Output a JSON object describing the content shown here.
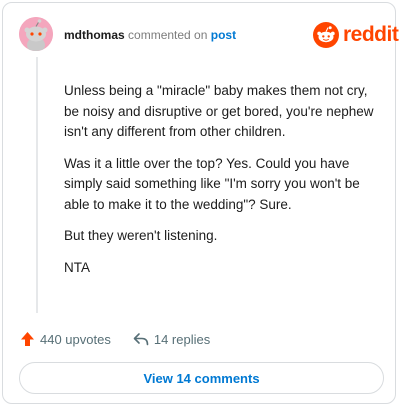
{
  "comment": {
    "username": "mdthomas",
    "verb": "commented on",
    "target": "post",
    "paragraphs": [
      "Unless being a \"miracle\" baby makes them not cry, be noisy and disruptive or get bored, you're nephew isn't any different from other children.",
      "Was it a little over the top? Yes. Could you have simply said something like \"I'm sorry you won't be able to make it to the wedding\"? Sure.",
      "But they weren't listening.",
      "NTA"
    ]
  },
  "brand": {
    "name": "reddit",
    "color": "#ff4500"
  },
  "actions": {
    "upvotes": "440 upvotes",
    "replies": "14 replies",
    "upvote_icon": "upvote-arrow-icon",
    "reply_icon": "reply-arrow-icon"
  },
  "footer": {
    "view_comments": "View 14 comments"
  },
  "colors": {
    "avatar_bg": "#f4a6bd",
    "link": "#0079d3",
    "muted": "#7c7c7c",
    "upvote": "#ff4500"
  }
}
